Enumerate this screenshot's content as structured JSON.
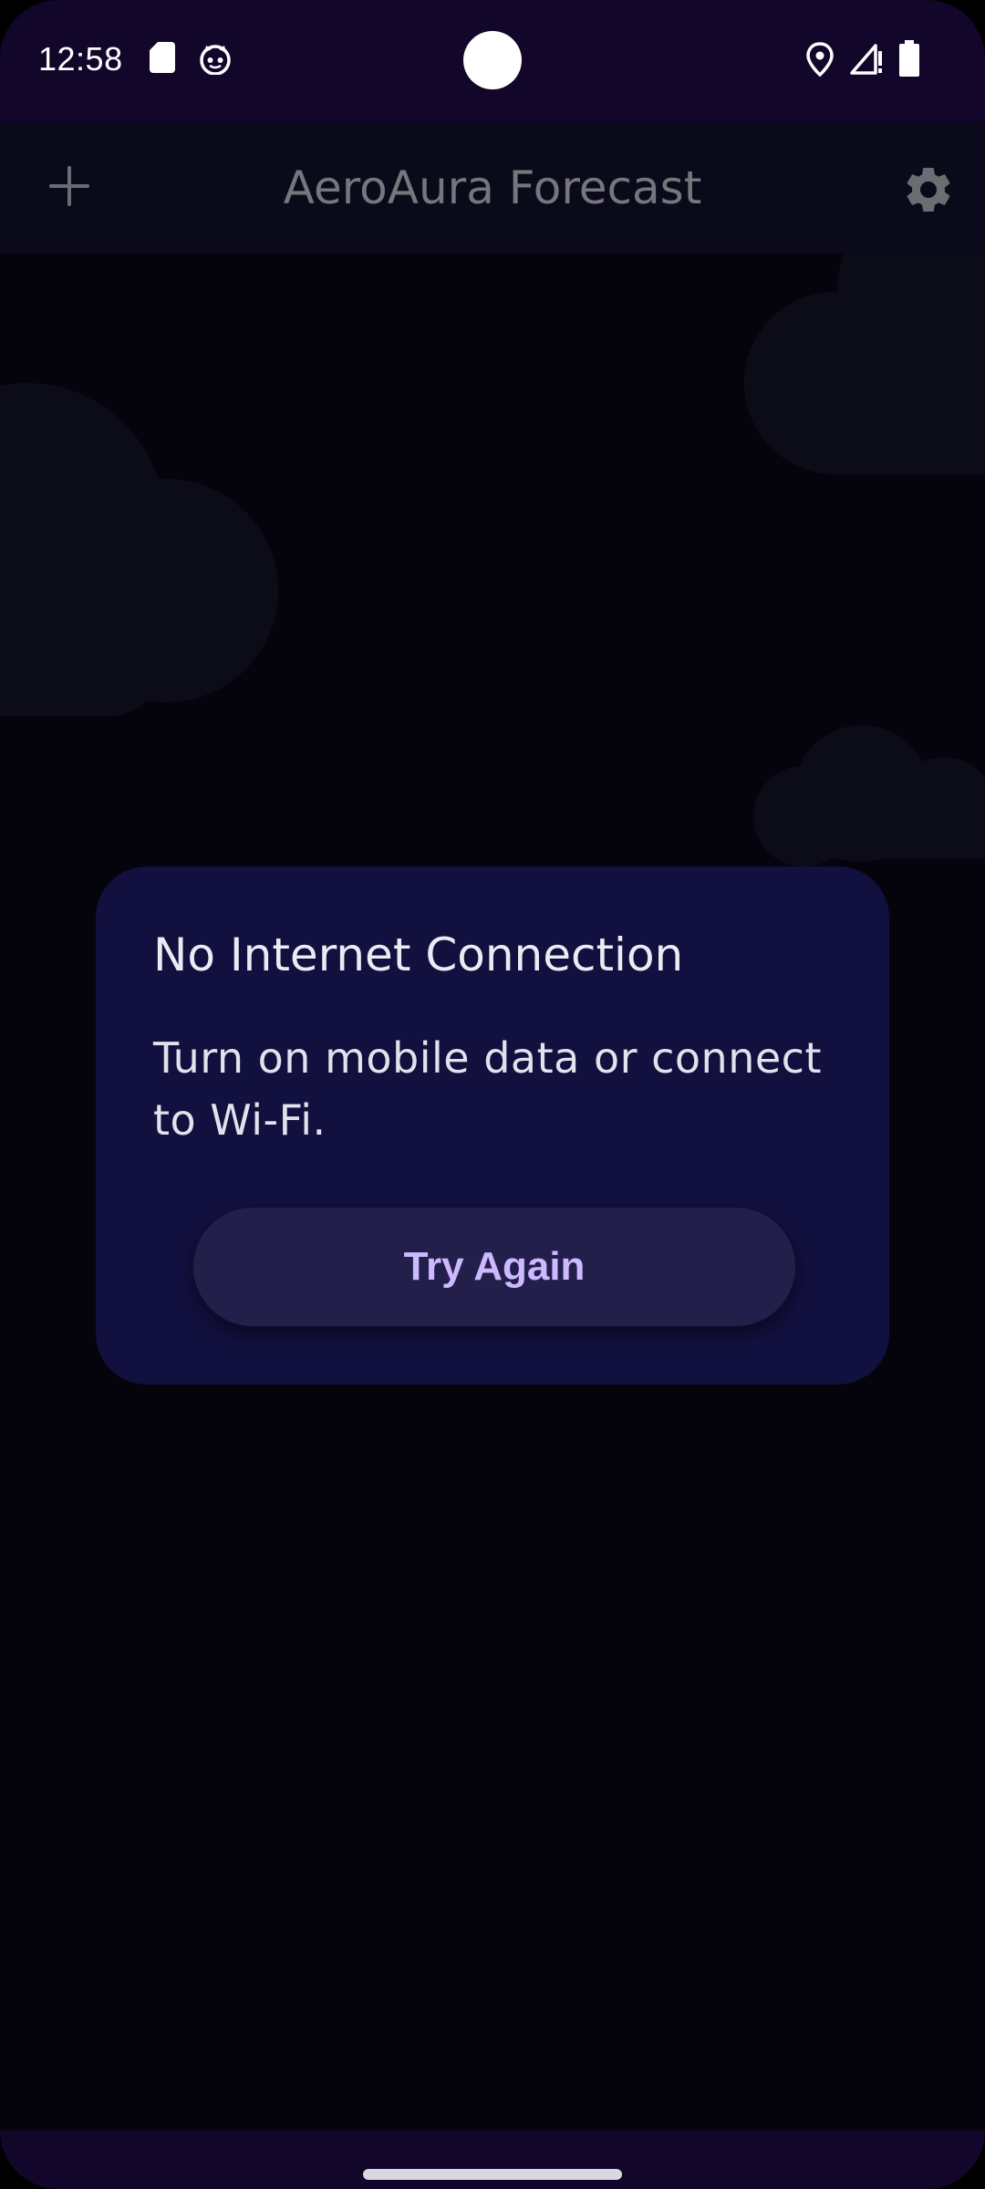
{
  "status_bar": {
    "time": "12:58",
    "left_icons": [
      "sd-card-icon",
      "cat-face-icon"
    ],
    "right_icons": [
      "location-icon",
      "signal-icon",
      "battery-icon"
    ]
  },
  "app_bar": {
    "title": "AeroAura Forecast",
    "left_action_icon": "plus-icon",
    "right_action_icon": "gear-icon"
  },
  "dialog": {
    "title": "No Internet Connection",
    "message": "Turn on mobile data or connect to Wi-Fi.",
    "button_label": "Try Again"
  },
  "colors": {
    "background": "#05040d",
    "status_bar": "#12072b",
    "app_bar": "#0a0a1a",
    "dialog": "#12103e",
    "button": "#22204a",
    "button_text": "#cdb9ff",
    "title_text": "#76767d"
  }
}
